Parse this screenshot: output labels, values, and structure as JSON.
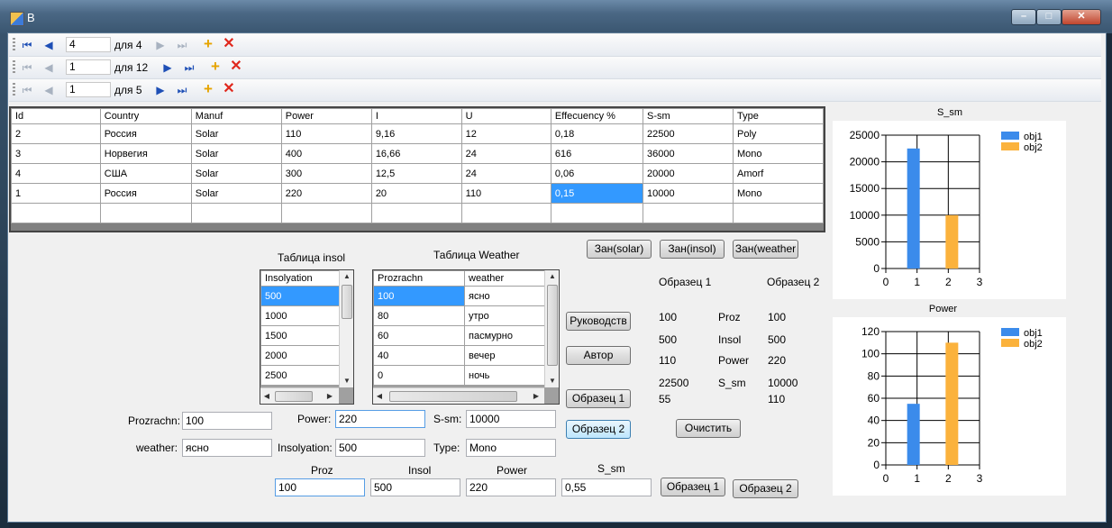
{
  "window": {
    "title": "B"
  },
  "navigators": [
    {
      "position": "4",
      "count": "для 4",
      "first_disabled": false,
      "next_disabled": true
    },
    {
      "position": "1",
      "count": "для 12",
      "first_disabled": true,
      "next_disabled": false
    },
    {
      "position": "1",
      "count": "для 5",
      "first_disabled": true,
      "next_disabled": false
    }
  ],
  "main_grid": {
    "columns": [
      "Id",
      "Country",
      "Manuf",
      "Power",
      "I",
      "U",
      "Effecuency %",
      "S-sm",
      "Type"
    ],
    "rows": [
      [
        "2",
        "Россия",
        "Solar",
        "110",
        "9,16",
        "12",
        "0,18",
        "22500",
        "Poly"
      ],
      [
        "3",
        "Норвегия",
        "Solar",
        "400",
        "16,66",
        "24",
        "616",
        "36000",
        "Mono"
      ],
      [
        "4",
        "США",
        "Solar",
        "300",
        "12,5",
        "24",
        "0,06",
        "20000",
        "Amorf"
      ],
      [
        "1",
        "Россия",
        "Solar",
        "220",
        "20",
        "110",
        "0,15",
        "10000",
        "Mono"
      ]
    ]
  },
  "insol_table": {
    "caption": "Таблица insol",
    "column": "Insolyation",
    "rows": [
      "500",
      "1000",
      "1500",
      "2000",
      "2500"
    ]
  },
  "weather_table": {
    "caption": "Таблица Weather",
    "columns": [
      "Prozrachn",
      "weather"
    ],
    "rows": [
      [
        "100",
        "ясно"
      ],
      [
        "80",
        "утро"
      ],
      [
        "60",
        "пасмурно"
      ],
      [
        "40",
        "вечер"
      ],
      [
        "0",
        "ночь"
      ]
    ]
  },
  "buttons": {
    "zan_solar": "Зан(solar)",
    "zan_insol": "Зан(insol)",
    "zan_weather": "Зан(weather",
    "guide": "Руководств",
    "author": "Автор",
    "sample1": "Образец 1",
    "sample2": "Образец 2",
    "clear": "Очистить",
    "sample1_bottom": "Образец 1",
    "sample2_bottom": "Образец 2"
  },
  "comparison": {
    "header1": "Образец 1",
    "header2": "Образец 2",
    "rows": [
      {
        "v1": "100",
        "label": "Proz",
        "v2": "100"
      },
      {
        "v1": "500",
        "label": "Insol",
        "v2": "500"
      },
      {
        "v1": "110",
        "label": "Power",
        "v2": "220"
      },
      {
        "v1": "22500",
        "label": "S_sm",
        "v2": "10000"
      }
    ],
    "extra1": "55",
    "extra2": "110"
  },
  "form": {
    "prozrachn_label": "Prozrachn:",
    "prozrachn_value": "100",
    "weather_label": "weather:",
    "weather_value": "ясно",
    "power_label": "Power:",
    "power_value": "220",
    "insolyation_label": "Insolyation:",
    "insolyation_value": "500",
    "ssm_label": "S-sm:",
    "ssm_value": "10000",
    "type_label": "Type:",
    "type_value": "Mono"
  },
  "bottom": {
    "labels": [
      "Proz",
      "Insol",
      "Power",
      "S_sm"
    ],
    "values": [
      "100",
      "500",
      "220",
      "0,55"
    ]
  },
  "colors": {
    "obj1": "#3b8beb",
    "obj2": "#fbb23c",
    "selection": "#3399ff"
  },
  "chart_data": [
    {
      "type": "bar",
      "title": "S_sm",
      "series": [
        {
          "name": "obj1",
          "x": [
            1
          ],
          "values": [
            22500
          ]
        },
        {
          "name": "obj2",
          "x": [
            2
          ],
          "values": [
            10000
          ]
        }
      ],
      "xlim": [
        0,
        3
      ],
      "ylim": [
        0,
        25000
      ],
      "xticks": [
        "0",
        "1",
        "2",
        "3"
      ],
      "yticks": [
        "0",
        "5000",
        "10000",
        "15000",
        "20000",
        "25000"
      ],
      "grid": true,
      "legend": "top-right"
    },
    {
      "type": "bar",
      "title": "Power",
      "series": [
        {
          "name": "obj1",
          "x": [
            1
          ],
          "values": [
            55
          ]
        },
        {
          "name": "obj2",
          "x": [
            2
          ],
          "values": [
            110
          ]
        }
      ],
      "xlim": [
        0,
        3
      ],
      "ylim": [
        0,
        120
      ],
      "xticks": [
        "0",
        "1",
        "2",
        "3"
      ],
      "yticks": [
        "0",
        "20",
        "40",
        "60",
        "80",
        "100",
        "120"
      ],
      "grid": true,
      "legend": "top-right"
    }
  ]
}
